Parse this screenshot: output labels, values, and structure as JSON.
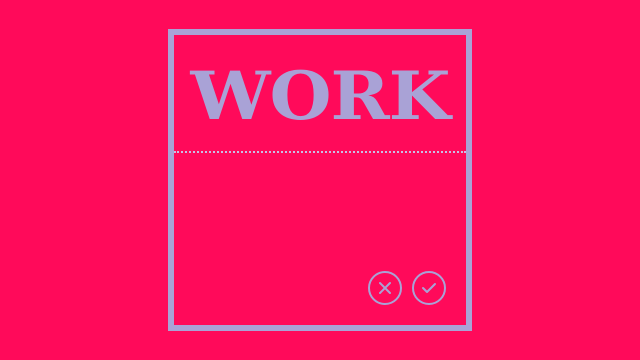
{
  "card": {
    "title": "WORK"
  },
  "actions": {
    "cancel_icon": "close-icon",
    "confirm_icon": "check-icon"
  },
  "colors": {
    "background": "#ff0a5a",
    "accent": "#a9a2d6"
  }
}
